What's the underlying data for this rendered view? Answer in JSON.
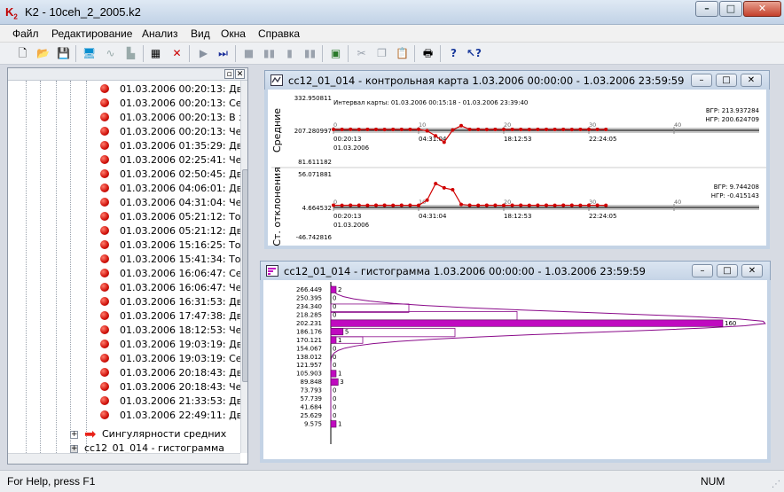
{
  "app": {
    "title": "K2 - 10ceh_2_2005.k2",
    "icon": "K2"
  },
  "window_controls": {
    "minimize": "–",
    "maximize": "□",
    "close": "✕"
  },
  "menu": [
    "Файл",
    "Редактирование",
    "Анализ",
    "Вид",
    "Окна",
    "Справка"
  ],
  "toolbar": [
    "new-file-icon",
    "open-folder-icon",
    "save-icon",
    "monitor-icon",
    "chart-line-icon",
    "chart-bar-icon",
    "properties-icon",
    "delete-icon",
    "play-icon",
    "fast-forward-icon",
    "stop-icon",
    "pause-icon",
    "step-icon",
    "step-back-icon",
    "picture-icon",
    "cut-icon",
    "copy-icon",
    "paste-icon",
    "print-icon",
    "help-icon",
    "context-help-icon"
  ],
  "tree": {
    "rows": [
      "01.03.2006 00:20:13: Две",
      "01.03.2006 00:20:13: Семь",
      "01.03.2006 00:20:13: В зо",
      "01.03.2006 00:20:13: Четы",
      "01.03.2006 01:35:29: Две",
      "01.03.2006 02:25:41: Четы",
      "01.03.2006 02:50:45: Две",
      "01.03.2006 04:06:01: Две",
      "01.03.2006 04:31:04: Четы",
      "01.03.2006 05:21:12: Точк",
      "01.03.2006 05:21:12: Две",
      "01.03.2006 15:16:25: Точк",
      "01.03.2006 15:41:34: Точк",
      "01.03.2006 16:06:47: Семь",
      "01.03.2006 16:06:47: Четы",
      "01.03.2006 16:31:53: Две",
      "01.03.2006 17:47:38: Две",
      "01.03.2006 18:12:53: Четы",
      "01.03.2006 19:03:19: Две",
      "01.03.2006 19:03:19: Семь",
      "01.03.2006 20:18:43: Две",
      "01.03.2006 20:18:43: Четы",
      "01.03.2006 21:33:53: Две",
      "01.03.2006 22:49:11: Две"
    ],
    "singular_node": "Сингулярности средних",
    "hist_node": "cc12_01_014 - гистограмма"
  },
  "control_chart": {
    "title": "cc12_01_014 - контрольная карта  1.03.2006 00:00:00 - 1.03.2006 23:59:59",
    "interval_label": "Интервал карты: 01.03.2006 00:15:18 - 01.03.2006 23:39:40",
    "mean_panel": {
      "ylabel": "Средние",
      "y_top": "332.950811",
      "y_mid": "207.280997",
      "y_bot": "81.611182",
      "vgr": "ВГР: 213.937284",
      "ngr": "НГР: 200.624709",
      "x_ticks": [
        "0",
        "10",
        "20",
        "30",
        "40"
      ],
      "time_ticks": [
        "00:20:13",
        "04:31:04",
        "18:12:53",
        "22:24:05"
      ],
      "date_label": "01.03.2006"
    },
    "sd_panel": {
      "ylabel": "Ст. отклонения",
      "y_top": "56.071881",
      "y_mid": "4.664532",
      "y_bot": "-46.742816",
      "vgr": "ВГР: 9.744208",
      "ngr": "НГР: -0.415143",
      "x_ticks": [
        "0",
        "10",
        "20",
        "30",
        "40"
      ],
      "time_ticks": [
        "00:20:13",
        "04:31:04",
        "18:12:53",
        "22:24:05"
      ],
      "date_label": "01.03.2006"
    }
  },
  "histogram": {
    "title": "cc12_01_014 - гистограмма  1.03.2006 00:00:00 - 1.03.2006 23:59:59"
  },
  "chart_data": [
    {
      "type": "line",
      "title": "",
      "ylabel": "Средние",
      "ylim": [
        81.611182,
        332.950811
      ],
      "center_line": 207.280997,
      "ucl": 213.937284,
      "lcl": 200.624709,
      "x": [
        0,
        1,
        2,
        3,
        4,
        5,
        6,
        7,
        8,
        9,
        10,
        11,
        12,
        13,
        14,
        15,
        16,
        17,
        18,
        19,
        20,
        21,
        22,
        23,
        24,
        25,
        26,
        27,
        28,
        29,
        30,
        31,
        32
      ],
      "values": [
        207.3,
        207.1,
        207.5,
        206.9,
        207.2,
        207.4,
        207.0,
        207.3,
        207.1,
        207.2,
        207.5,
        202.0,
        182.0,
        157.0,
        205.0,
        222.0,
        207.3,
        207.2,
        207.0,
        207.4,
        207.1,
        207.3,
        207.2,
        207.0,
        207.4,
        207.3,
        207.1,
        207.2,
        207.0,
        207.3,
        207.2,
        207.1,
        207.3
      ]
    },
    {
      "type": "line",
      "title": "",
      "ylabel": "Ст. отклонения",
      "ylim": [
        -46.742816,
        56.071881
      ],
      "center_line": 4.664532,
      "ucl": 9.744208,
      "lcl": -0.415143,
      "x": [
        0,
        1,
        2,
        3,
        4,
        5,
        6,
        7,
        8,
        9,
        10,
        11,
        12,
        13,
        14,
        15,
        16,
        17,
        18,
        19,
        20,
        21,
        22,
        23,
        24,
        25,
        26,
        27,
        28,
        29,
        30,
        31,
        32
      ],
      "values": [
        4.6,
        4.5,
        4.7,
        4.6,
        4.4,
        4.6,
        4.7,
        4.5,
        4.6,
        4.6,
        4.5,
        13.0,
        40.0,
        33.0,
        30.0,
        6.0,
        4.6,
        4.5,
        4.7,
        4.6,
        4.5,
        4.6,
        4.7,
        4.5,
        4.6,
        4.6,
        4.5,
        4.7,
        4.6,
        4.5,
        4.6,
        4.6,
        4.5
      ]
    },
    {
      "type": "bar",
      "title": "",
      "orientation": "horizontal",
      "categories": [
        "266.449",
        "250.395",
        "234.340",
        "218.285",
        "202.231",
        "186.176",
        "170.121",
        "154.067",
        "138.012",
        "121.957",
        "105.903",
        "89.848",
        "73.793",
        "57.739",
        "41.684",
        "25.629",
        "9.575"
      ],
      "values": [
        2,
        0,
        0,
        0,
        160,
        5,
        1,
        0,
        0,
        0,
        1,
        3,
        0,
        0,
        0,
        0,
        1
      ],
      "xlim": [
        0,
        160
      ]
    }
  ],
  "status": {
    "help": "For Help, press F1",
    "num": "NUM"
  }
}
